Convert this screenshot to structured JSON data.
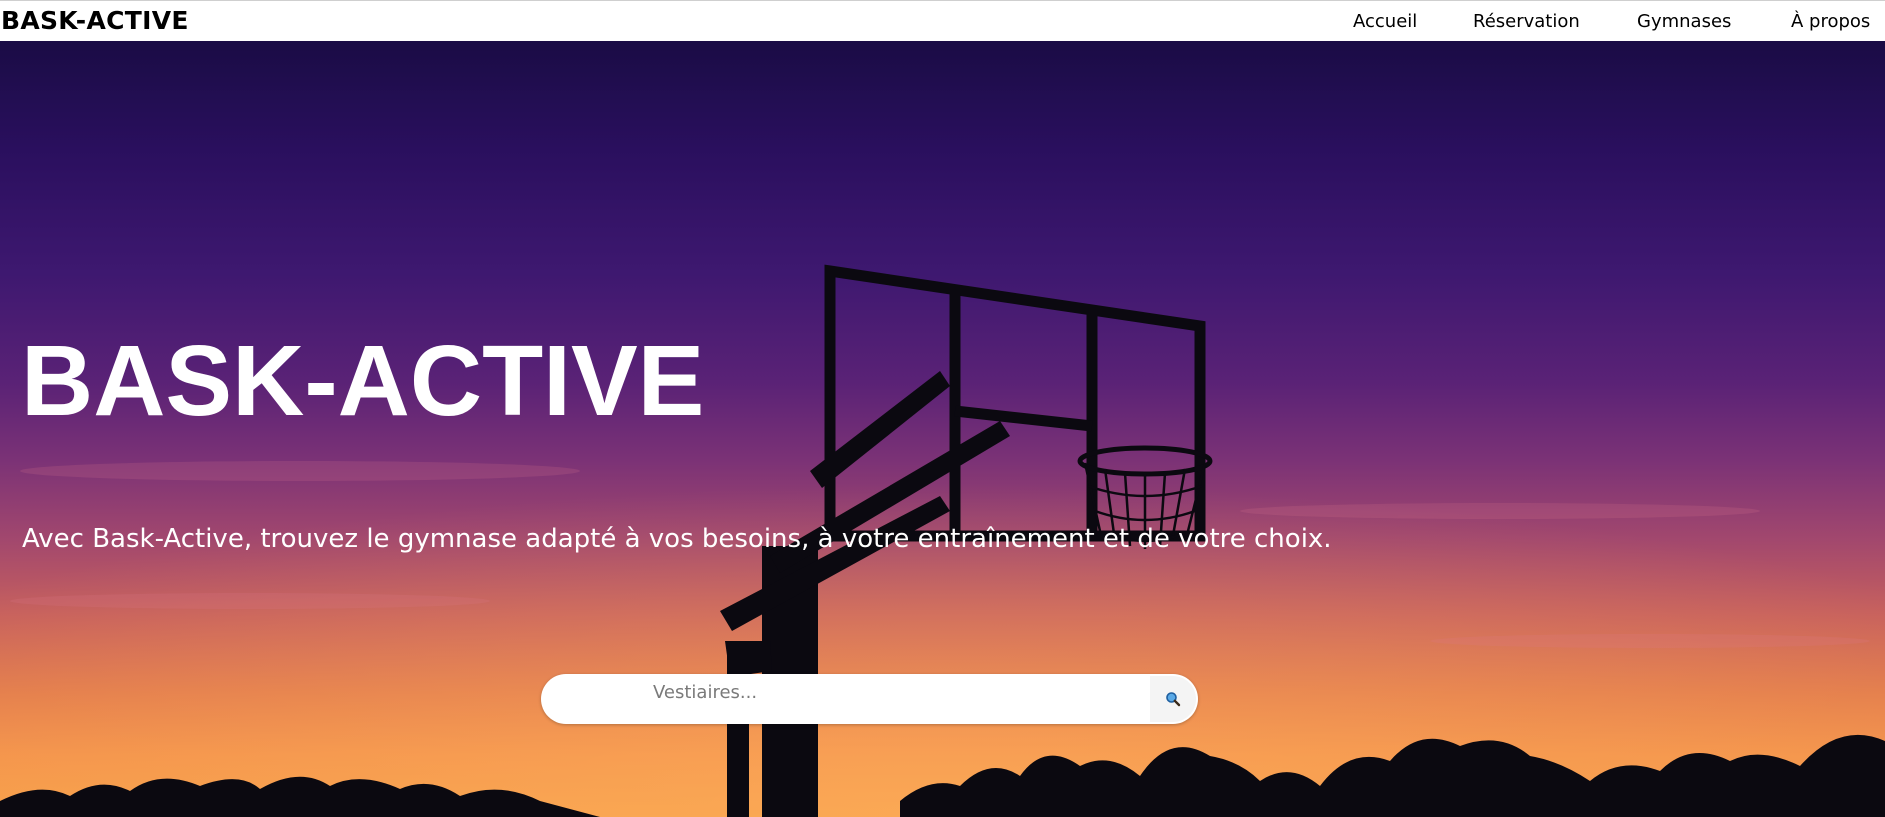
{
  "header": {
    "brand": "BASK-ACTIVE",
    "nav": [
      {
        "label": "Accueil"
      },
      {
        "label": "Réservation"
      },
      {
        "label": "Gymnases"
      },
      {
        "label": "À propos"
      }
    ]
  },
  "hero": {
    "title": "BASK-ACTIVE",
    "subtitle": "Avec Bask-Active, trouvez le gymnase adapté à vos besoins, à votre entraînement et de votre choix.",
    "background_image": "basketball-hoop-silhouette-at-sunset"
  },
  "search": {
    "placeholder": "Vestiaires...",
    "value": "",
    "button_icon": "search-icon"
  },
  "colors": {
    "header_bg": "#ffffff",
    "text_dark": "#000000",
    "hero_text": "#ffffff",
    "sky_top": "#1a0c45",
    "sky_mid": "#7b3276",
    "sky_bottom": "#f6a048",
    "search_icon": "#1e88e5"
  }
}
